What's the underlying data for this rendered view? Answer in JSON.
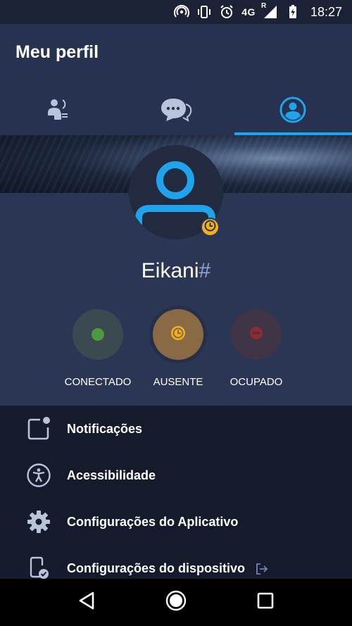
{
  "status_bar": {
    "network": "4G",
    "roaming": "R",
    "time": "18:27",
    "icons": [
      "hotspot-icon",
      "vibrate-icon",
      "alarm-icon",
      "signal-icon",
      "battery-charging-icon"
    ]
  },
  "header": {
    "title": "Meu perfil",
    "tabs": [
      {
        "icon": "contacts-icon",
        "active": false
      },
      {
        "icon": "chat-icon",
        "active": false
      },
      {
        "icon": "profile-icon",
        "active": true
      }
    ],
    "accent": "#1fa3ea"
  },
  "profile": {
    "username": "Eikani",
    "username_suffix": "#",
    "avatar_icon": "user-icon",
    "badge_icon": "clock-icon",
    "badge_color": "#f2b01e"
  },
  "statuses": [
    {
      "label": "CONECTADO",
      "icon": "online-dot-icon",
      "color": "#4b9b3e",
      "selected": false
    },
    {
      "label": "AUSENTE",
      "icon": "clock-icon",
      "color": "#f2b01e",
      "selected": true
    },
    {
      "label": "OCUPADO",
      "icon": "busy-icon",
      "color": "#8b2b34",
      "selected": false
    }
  ],
  "menu": {
    "items": [
      {
        "label": "Notificações",
        "icon": "notification-icon"
      },
      {
        "label": "Acessibilidade",
        "icon": "accessibility-icon"
      },
      {
        "label": "Configurações do Aplicativo",
        "icon": "gear-icon"
      },
      {
        "label": "Configurações do dispositivo",
        "icon": "device-settings-icon",
        "trailing_icon": "external-link-icon"
      }
    ]
  },
  "nav": [
    "back-icon",
    "home-icon",
    "recents-icon"
  ]
}
